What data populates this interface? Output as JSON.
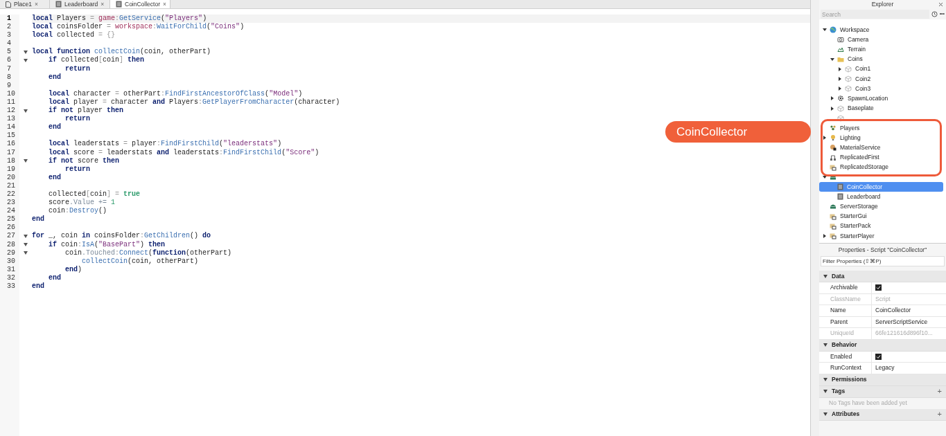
{
  "tabs": [
    {
      "label": "Place1",
      "kind": "place",
      "selected": false,
      "close": "×"
    },
    {
      "label": "Leaderboard",
      "kind": "script",
      "selected": false,
      "close": "×"
    },
    {
      "label": "CoinCollector",
      "kind": "script",
      "selected": true,
      "close": "×"
    }
  ],
  "editor": {
    "lines": [
      {
        "n": "1",
        "fold": false,
        "current": true,
        "tokens": [
          {
            "kind": "keyword",
            "text": "local"
          },
          {
            "kind": "plain",
            "text": " Players "
          },
          {
            "kind": "operator",
            "text": "= "
          },
          {
            "kind": "global",
            "text": "game"
          },
          {
            "kind": "operator",
            "text": ":"
          },
          {
            "kind": "method",
            "text": "GetService"
          },
          {
            "kind": "plain",
            "text": "("
          },
          {
            "kind": "string",
            "text": "\"Players\""
          },
          {
            "kind": "plain",
            "text": ")"
          }
        ]
      },
      {
        "n": "2",
        "fold": false,
        "current": false,
        "tokens": [
          {
            "kind": "keyword",
            "text": "local"
          },
          {
            "kind": "plain",
            "text": " coinsFolder "
          },
          {
            "kind": "operator",
            "text": "= "
          },
          {
            "kind": "global",
            "text": "workspace"
          },
          {
            "kind": "operator",
            "text": ":"
          },
          {
            "kind": "method",
            "text": "WaitForChild"
          },
          {
            "kind": "plain",
            "text": "("
          },
          {
            "kind": "string",
            "text": "\"Coins\""
          },
          {
            "kind": "plain",
            "text": ")"
          }
        ]
      },
      {
        "n": "3",
        "fold": false,
        "current": false,
        "tokens": [
          {
            "kind": "keyword",
            "text": "local"
          },
          {
            "kind": "plain",
            "text": " collected "
          },
          {
            "kind": "operator",
            "text": "= {}"
          }
        ]
      },
      {
        "n": "4",
        "fold": false,
        "current": false
      },
      {
        "n": "5",
        "fold": true,
        "current": false,
        "tokens": [
          {
            "kind": "keyword",
            "text": "local function "
          },
          {
            "kind": "method",
            "text": "collectCoin"
          },
          {
            "kind": "plain",
            "text": "(coin, otherPart)"
          }
        ]
      },
      {
        "n": "6",
        "fold": true,
        "current": false,
        "tokens": [
          {
            "kind": "keyword",
            "text": "    if"
          },
          {
            "kind": "plain",
            "text": " collected"
          },
          {
            "kind": "operator",
            "text": "["
          },
          {
            "kind": "plain",
            "text": "coin"
          },
          {
            "kind": "operator",
            "text": "]"
          },
          {
            "kind": "keyword",
            "text": " then"
          }
        ]
      },
      {
        "n": "7",
        "fold": false,
        "current": false,
        "tokens": [
          {
            "kind": "keyword",
            "text": "        return"
          }
        ]
      },
      {
        "n": "8",
        "fold": false,
        "current": false,
        "tokens": [
          {
            "kind": "keyword",
            "text": "    end"
          }
        ]
      },
      {
        "n": "9",
        "fold": false,
        "current": false
      },
      {
        "n": "10",
        "fold": false,
        "current": false,
        "tokens": [
          {
            "kind": "keyword",
            "text": "    local"
          },
          {
            "kind": "plain",
            "text": " character "
          },
          {
            "kind": "operator",
            "text": "="
          },
          {
            "kind": "plain",
            "text": " otherPart"
          },
          {
            "kind": "operator",
            "text": ":"
          },
          {
            "kind": "method",
            "text": "FindFirstAncestorOfClass"
          },
          {
            "kind": "plain",
            "text": "("
          },
          {
            "kind": "string",
            "text": "\"Model\""
          },
          {
            "kind": "plain",
            "text": ")"
          }
        ]
      },
      {
        "n": "11",
        "fold": false,
        "current": false,
        "tokens": [
          {
            "kind": "keyword",
            "text": "    local"
          },
          {
            "kind": "plain",
            "text": " player "
          },
          {
            "kind": "operator",
            "text": "="
          },
          {
            "kind": "plain",
            "text": " character "
          },
          {
            "kind": "keyword",
            "text": "and"
          },
          {
            "kind": "plain",
            "text": " Players"
          },
          {
            "kind": "operator",
            "text": ":"
          },
          {
            "kind": "method",
            "text": "GetPlayerFromCharacter"
          },
          {
            "kind": "plain",
            "text": "(character)"
          }
        ]
      },
      {
        "n": "12",
        "fold": true,
        "current": false,
        "tokens": [
          {
            "kind": "keyword",
            "text": "    if not"
          },
          {
            "kind": "plain",
            "text": " player "
          },
          {
            "kind": "keyword",
            "text": "then"
          }
        ]
      },
      {
        "n": "13",
        "fold": false,
        "current": false,
        "tokens": [
          {
            "kind": "keyword",
            "text": "        return"
          }
        ]
      },
      {
        "n": "14",
        "fold": false,
        "current": false,
        "tokens": [
          {
            "kind": "keyword",
            "text": "    end"
          }
        ]
      },
      {
        "n": "15",
        "fold": false,
        "current": false
      },
      {
        "n": "16",
        "fold": false,
        "current": false,
        "tokens": [
          {
            "kind": "keyword",
            "text": "    local"
          },
          {
            "kind": "plain",
            "text": " leaderstats "
          },
          {
            "kind": "operator",
            "text": "="
          },
          {
            "kind": "plain",
            "text": " player"
          },
          {
            "kind": "operator",
            "text": ":"
          },
          {
            "kind": "method",
            "text": "FindFirstChild"
          },
          {
            "kind": "plain",
            "text": "("
          },
          {
            "kind": "string",
            "text": "\"leaderstats\""
          },
          {
            "kind": "plain",
            "text": ")"
          }
        ]
      },
      {
        "n": "17",
        "fold": false,
        "current": false,
        "tokens": [
          {
            "kind": "keyword",
            "text": "    local"
          },
          {
            "kind": "plain",
            "text": " score "
          },
          {
            "kind": "operator",
            "text": "="
          },
          {
            "kind": "plain",
            "text": " leaderstats "
          },
          {
            "kind": "keyword",
            "text": "and"
          },
          {
            "kind": "plain",
            "text": " leaderstats"
          },
          {
            "kind": "operator",
            "text": ":"
          },
          {
            "kind": "method",
            "text": "FindFirstChild"
          },
          {
            "kind": "plain",
            "text": "("
          },
          {
            "kind": "string",
            "text": "\"Score\""
          },
          {
            "kind": "plain",
            "text": ")"
          }
        ]
      },
      {
        "n": "18",
        "fold": true,
        "current": false,
        "tokens": [
          {
            "kind": "keyword",
            "text": "    if not"
          },
          {
            "kind": "plain",
            "text": " score "
          },
          {
            "kind": "keyword",
            "text": "then"
          }
        ]
      },
      {
        "n": "19",
        "fold": false,
        "current": false,
        "tokens": [
          {
            "kind": "keyword",
            "text": "        return"
          }
        ]
      },
      {
        "n": "20",
        "fold": false,
        "current": false,
        "tokens": [
          {
            "kind": "keyword",
            "text": "    end"
          }
        ]
      },
      {
        "n": "21",
        "fold": false,
        "current": false
      },
      {
        "n": "22",
        "fold": false,
        "current": false,
        "tokens": [
          {
            "kind": "plain",
            "text": "    collected"
          },
          {
            "kind": "operator",
            "text": "["
          },
          {
            "kind": "plain",
            "text": "coin"
          },
          {
            "kind": "operator",
            "text": "] = "
          },
          {
            "kind": "boolean",
            "text": "true"
          }
        ]
      },
      {
        "n": "23",
        "fold": false,
        "current": false,
        "tokens": [
          {
            "kind": "plain",
            "text": "    score"
          },
          {
            "kind": "property",
            "text": ".Value += "
          },
          {
            "kind": "number",
            "text": "1"
          }
        ]
      },
      {
        "n": "24",
        "fold": false,
        "current": false,
        "tokens": [
          {
            "kind": "plain",
            "text": "    coin"
          },
          {
            "kind": "operator",
            "text": ":"
          },
          {
            "kind": "method",
            "text": "Destroy"
          },
          {
            "kind": "plain",
            "text": "()"
          }
        ]
      },
      {
        "n": "25",
        "fold": false,
        "current": false,
        "tokens": [
          {
            "kind": "keyword",
            "text": "end"
          }
        ]
      },
      {
        "n": "26",
        "fold": false,
        "current": false
      },
      {
        "n": "27",
        "fold": true,
        "current": false,
        "tokens": [
          {
            "kind": "keyword",
            "text": "for"
          },
          {
            "kind": "plain",
            "text": " _, coin "
          },
          {
            "kind": "keyword",
            "text": "in"
          },
          {
            "kind": "plain",
            "text": " coinsFolder"
          },
          {
            "kind": "operator",
            "text": ":"
          },
          {
            "kind": "method",
            "text": "GetChildren"
          },
          {
            "kind": "plain",
            "text": "() "
          },
          {
            "kind": "keyword",
            "text": "do"
          }
        ]
      },
      {
        "n": "28",
        "fold": true,
        "current": false,
        "tokens": [
          {
            "kind": "keyword",
            "text": "    if"
          },
          {
            "kind": "plain",
            "text": " coin"
          },
          {
            "kind": "operator",
            "text": ":"
          },
          {
            "kind": "method",
            "text": "IsA"
          },
          {
            "kind": "plain",
            "text": "("
          },
          {
            "kind": "string",
            "text": "\"BasePart\""
          },
          {
            "kind": "plain",
            "text": ") "
          },
          {
            "kind": "keyword",
            "text": "then"
          }
        ]
      },
      {
        "n": "29",
        "fold": true,
        "current": false,
        "tokens": [
          {
            "kind": "plain",
            "text": "        coin"
          },
          {
            "kind": "property",
            "text": ".Touched"
          },
          {
            "kind": "operator",
            "text": ":"
          },
          {
            "kind": "method",
            "text": "Connect"
          },
          {
            "kind": "plain",
            "text": "("
          },
          {
            "kind": "keyword",
            "text": "function"
          },
          {
            "kind": "plain",
            "text": "(otherPart)"
          }
        ]
      },
      {
        "n": "30",
        "fold": false,
        "current": false,
        "tokens": [
          {
            "kind": "method",
            "text": "            collectCoin"
          },
          {
            "kind": "plain",
            "text": "(coin, otherPart)"
          }
        ]
      },
      {
        "n": "31",
        "fold": false,
        "current": false,
        "tokens": [
          {
            "kind": "keyword",
            "text": "        end"
          },
          {
            "kind": "plain",
            "text": ")"
          }
        ]
      },
      {
        "n": "32",
        "fold": false,
        "current": false,
        "tokens": [
          {
            "kind": "keyword",
            "text": "    end"
          }
        ]
      },
      {
        "n": "33",
        "fold": false,
        "current": false,
        "tokens": [
          {
            "kind": "keyword",
            "text": "end"
          }
        ]
      }
    ]
  },
  "explorer": {
    "title": "Explorer",
    "search": {
      "placeholder": "Search"
    },
    "more": "•••",
    "tree": [
      {
        "label": "Workspace",
        "kind": "globe",
        "expandable": true,
        "expanded": true,
        "selected": false,
        "children": [
          {
            "label": "Camera",
            "kind": "camera",
            "expandable": false,
            "expanded": false,
            "selected": false
          },
          {
            "label": "Terrain",
            "kind": "terrain",
            "expandable": false,
            "expanded": false,
            "selected": false
          },
          {
            "label": "Coins",
            "kind": "folder",
            "expandable": true,
            "expanded": true,
            "selected": false,
            "children": [
              {
                "label": "Coin1",
                "kind": "part",
                "expandable": true,
                "expanded": false,
                "selected": false
              },
              {
                "label": "Coin2",
                "kind": "part",
                "expandable": true,
                "expanded": false,
                "selected": false
              },
              {
                "label": "Coin3",
                "kind": "part",
                "expandable": true,
                "expanded": false,
                "selected": false
              }
            ]
          },
          {
            "label": "SpawnLocation",
            "kind": "gear",
            "expandable": true,
            "expanded": false,
            "selected": false
          },
          {
            "label": "Baseplate",
            "kind": "part",
            "expandable": true,
            "expanded": false,
            "selected": false
          },
          {
            "kind": "part",
            "expandable": false,
            "expanded": false,
            "selected": false
          }
        ]
      },
      {
        "label": "Players",
        "kind": "players",
        "expandable": false,
        "expanded": false,
        "selected": false
      },
      {
        "label": "Lighting",
        "kind": "bulb",
        "expandable": true,
        "expanded": false,
        "selected": false
      },
      {
        "label": "MaterialService",
        "kind": "material",
        "expandable": false,
        "expanded": false,
        "selected": false
      },
      {
        "label": "ReplicatedFirst",
        "kind": "replicated",
        "expandable": false,
        "expanded": false,
        "selected": false
      },
      {
        "label": "ReplicatedStorage",
        "kind": "storage",
        "expandable": false,
        "expanded": false,
        "selected": false
      },
      {
        "kind": "server",
        "expandable": true,
        "expanded": true,
        "selected": false,
        "children": [
          {
            "label": "CoinCollector",
            "kind": "script",
            "expandable": false,
            "expanded": false,
            "selected": true
          },
          {
            "label": "Leaderboard",
            "kind": "script",
            "expandable": false,
            "expanded": false,
            "selected": false
          }
        ]
      },
      {
        "label": "ServerStorage",
        "kind": "server",
        "expandable": false,
        "expanded": false,
        "selected": false
      },
      {
        "label": "StarterGui",
        "kind": "storage",
        "expandable": false,
        "expanded": false,
        "selected": false
      },
      {
        "label": "StarterPack",
        "kind": "storage",
        "expandable": false,
        "expanded": false,
        "selected": false
      },
      {
        "label": "StarterPlayer",
        "kind": "storage",
        "expandable": true,
        "expanded": false,
        "selected": false
      }
    ]
  },
  "properties": {
    "title": "Properties - Script \"CoinCollector\"",
    "filter": {
      "placeholder": "Filter Properties (⇧⌘P)"
    },
    "sections": [
      {
        "name": "Data",
        "expanded": true,
        "rows": [
          {
            "name": "Archivable",
            "kind": "check",
            "checked": true,
            "disabled": false
          },
          {
            "name": "ClassName",
            "kind": "text",
            "value": "Script",
            "disabled": true
          },
          {
            "name": "Name",
            "kind": "text",
            "value": "CoinCollector",
            "disabled": false
          },
          {
            "name": "Parent",
            "kind": "text",
            "value": "ServerScriptService",
            "disabled": false
          },
          {
            "name": "UniqueId",
            "kind": "text",
            "value": "66fe121616d896f10...",
            "disabled": true
          }
        ]
      },
      {
        "name": "Behavior",
        "expanded": true,
        "rows": [
          {
            "name": "Enabled",
            "kind": "check",
            "checked": true,
            "disabled": false
          },
          {
            "name": "RunContext",
            "kind": "text",
            "value": "Legacy",
            "disabled": false
          }
        ]
      },
      {
        "name": "Permissions",
        "expanded": true
      },
      {
        "name": "Tags",
        "expanded": true,
        "add": "+",
        "note": "No Tags have been added yet"
      },
      {
        "name": "Attributes",
        "expanded": true,
        "add": "+"
      }
    ]
  },
  "callout": {
    "label": "CoinCollector"
  }
}
